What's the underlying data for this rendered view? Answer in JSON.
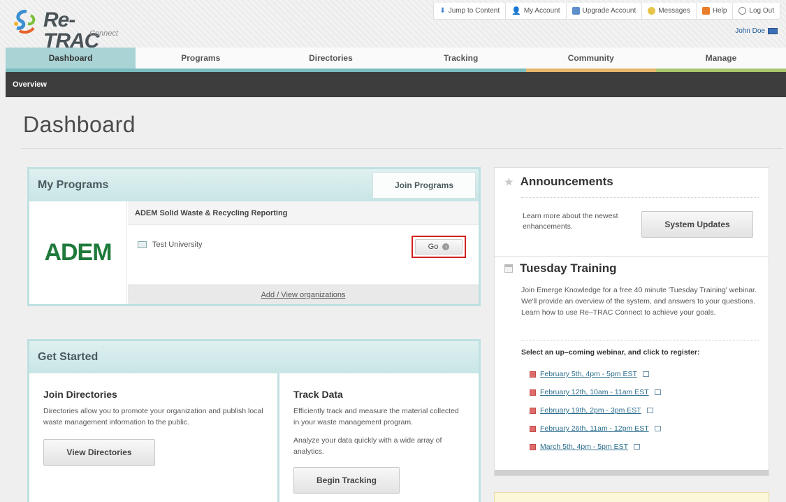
{
  "brand": {
    "name": "Re-TRAC",
    "tagline": "Connect"
  },
  "topbar": {
    "items": [
      {
        "label": "Jump to Content",
        "icon": "down-arrow-icon",
        "color": "#3f7fd0"
      },
      {
        "label": "My Account",
        "icon": "user-icon",
        "color": "#555555"
      },
      {
        "label": "Upgrade Account",
        "icon": "upgrade-icon",
        "color": "#5d8fc9"
      },
      {
        "label": "Messages",
        "icon": "chat-bubble-icon",
        "color": "#e8c44a"
      },
      {
        "label": "Help",
        "icon": "help-icon",
        "color": "#e87d2a"
      },
      {
        "label": "Log Out",
        "icon": "logout-icon",
        "color": "#888888"
      }
    ],
    "user_name": "John Doe"
  },
  "nav": {
    "items": [
      {
        "label": "Dashboard",
        "active": true
      },
      {
        "label": "Programs"
      },
      {
        "label": "Directories"
      },
      {
        "label": "Tracking"
      },
      {
        "label": "Community"
      },
      {
        "label": "Manage"
      }
    ]
  },
  "subnav": {
    "items": [
      "Overview"
    ]
  },
  "page": {
    "title": "Dashboard"
  },
  "my_programs": {
    "title": "My Programs",
    "join_label": "Join Programs",
    "program": {
      "logo_text": "ADEM",
      "name": "ADEM Solid Waste & Recycling Reporting",
      "organization": "Test University",
      "go_label": "Go",
      "add_view_label": "Add / View organizations"
    }
  },
  "get_started": {
    "title": "Get Started",
    "join_directories": {
      "heading": "Join Directories",
      "text": "Directories allow you to promote your organization and publish local waste management information to the public.",
      "button": "View Directories"
    },
    "track_data": {
      "heading": "Track Data",
      "text1": "Efficiently track and measure the material collected in your waste management program.",
      "text2": "Analyze your data quickly with a wide array of analytics.",
      "button": "Begin Tracking"
    }
  },
  "announcements": {
    "title": "Announcements",
    "text": "Learn more about the newest enhancements.",
    "button": "System Updates"
  },
  "training": {
    "title": "Tuesday Training",
    "text": "Join Emerge Knowledge for a free 40 minute 'Tuesday Training' webinar. We'll provide an overview of the system, and answers to your questions. Learn how to use Re–TRAC Connect to achieve your goals.",
    "select_label": "Select an up–coming webinar, and click to register:",
    "webinars": [
      "February 5th, 4pm - 5pm EST",
      "February 12th, 10am - 11am EST",
      "February 19th, 2pm - 3pm EST",
      "February 26th, 11am - 12pm EST",
      "March 5th, 4pm - 5pm EST"
    ]
  }
}
